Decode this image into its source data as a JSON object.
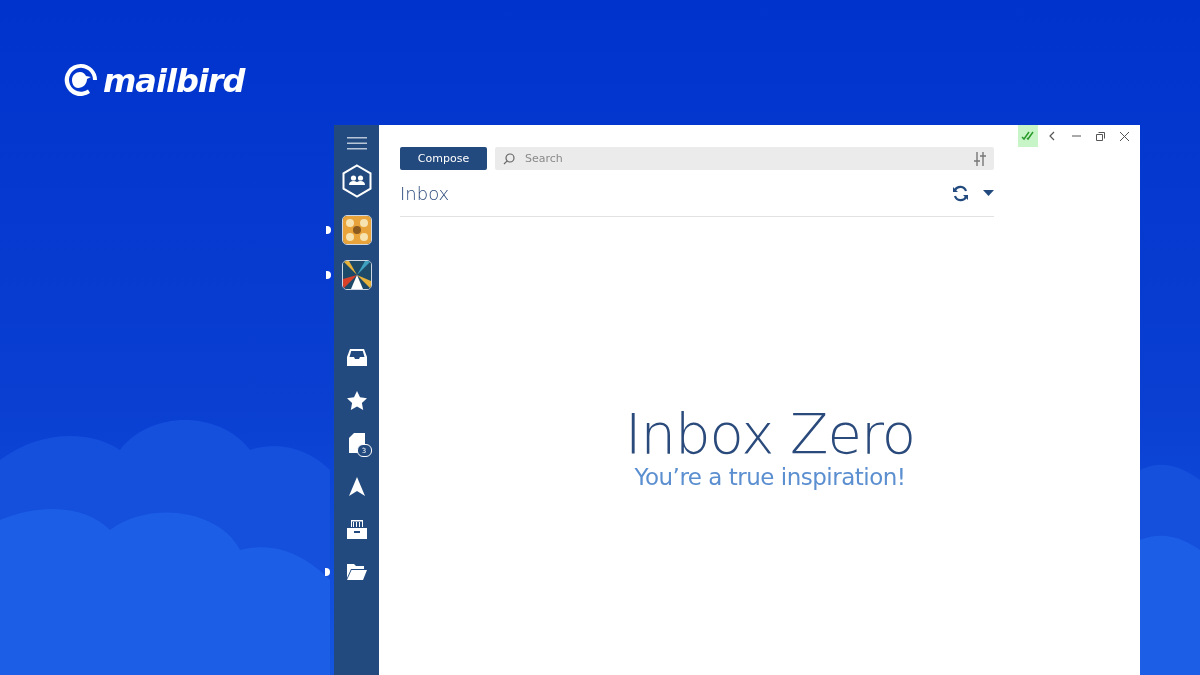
{
  "brand": {
    "name": "mailbird"
  },
  "sidebar": {
    "accounts": [
      {
        "kind": "picture",
        "dot": true
      },
      {
        "kind": "picture",
        "dot": true
      }
    ],
    "folders": [
      {
        "dot": false
      },
      {
        "dot": false
      },
      {
        "dot": false,
        "badge": "3"
      },
      {
        "dot": false
      },
      {
        "dot": false
      },
      {
        "dot": true
      }
    ]
  },
  "toolbar": {
    "compose": "Compose",
    "search": {
      "placeholder": "Search"
    }
  },
  "mailbox": {
    "title": "Inbox"
  },
  "empty_state": {
    "heading": "Inbox Zero",
    "message": "You’re a true inspiration!"
  }
}
